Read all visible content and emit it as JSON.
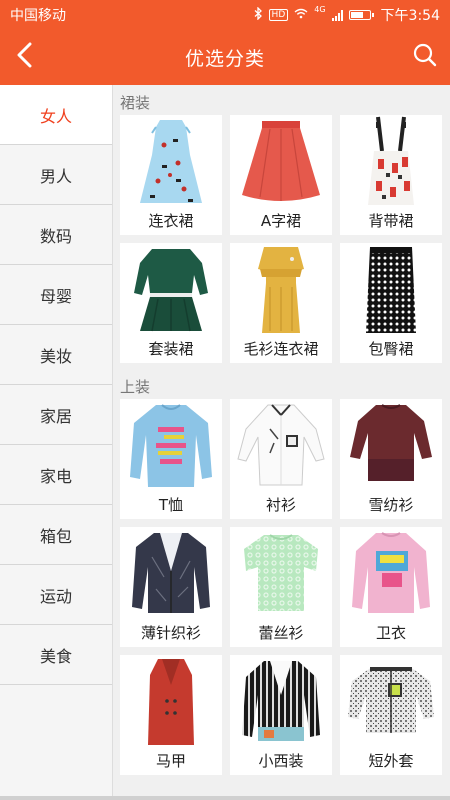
{
  "statusbar": {
    "carrier": "中国移动",
    "hd": "HD",
    "net": "4G",
    "time": "下午3:54",
    "battery_level": 0.8
  },
  "header": {
    "title": "优选分类"
  },
  "sidebar": {
    "items": [
      {
        "label": "女人"
      },
      {
        "label": "男人"
      },
      {
        "label": "数码"
      },
      {
        "label": "母婴"
      },
      {
        "label": "美妆"
      },
      {
        "label": "家居"
      },
      {
        "label": "家电"
      },
      {
        "label": "箱包"
      },
      {
        "label": "运动"
      },
      {
        "label": "美食"
      }
    ],
    "active": "女人"
  },
  "sections": [
    {
      "title": "裙装",
      "items": [
        {
          "label": "连衣裙",
          "image": "dress-icon"
        },
        {
          "label": "A字裙",
          "image": "a-line-skirt-icon"
        },
        {
          "label": "背带裙",
          "image": "suspender-skirt-icon"
        },
        {
          "label": "套装裙",
          "image": "skirt-suit-icon"
        },
        {
          "label": "毛衫连衣裙",
          "image": "sweater-dress-icon"
        },
        {
          "label": "包臀裙",
          "image": "pencil-skirt-icon"
        }
      ]
    },
    {
      "title": "上装",
      "items": [
        {
          "label": "T恤",
          "image": "tshirt-icon"
        },
        {
          "label": "衬衫",
          "image": "shirt-icon"
        },
        {
          "label": "雪纺衫",
          "image": "chiffon-top-icon"
        },
        {
          "label": "薄针织衫",
          "image": "cardigan-icon"
        },
        {
          "label": "蕾丝衫",
          "image": "lace-top-icon"
        },
        {
          "label": "卫衣",
          "image": "hoodie-icon"
        },
        {
          "label": "马甲",
          "image": "vest-icon"
        },
        {
          "label": "小西装",
          "image": "blazer-icon"
        },
        {
          "label": "短外套",
          "image": "short-jacket-icon"
        }
      ]
    }
  ],
  "colors": {
    "brand": "#f25a2c",
    "active_text": "#f0411f"
  }
}
